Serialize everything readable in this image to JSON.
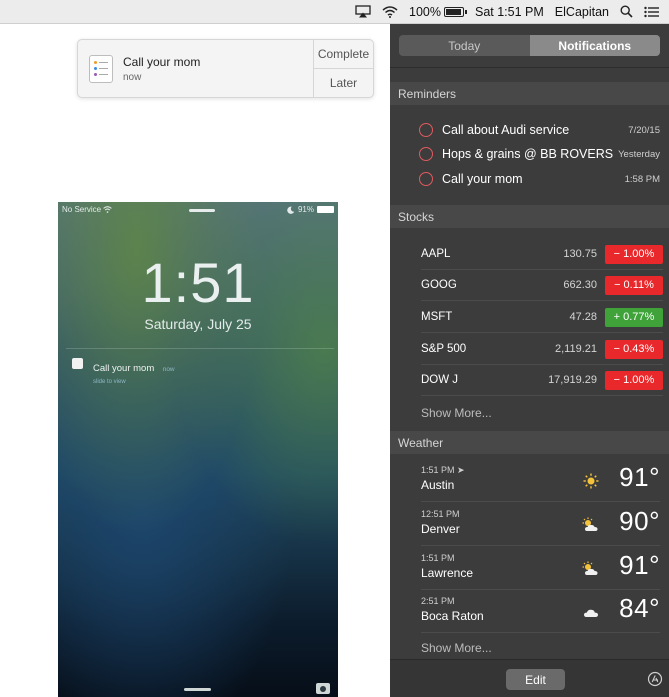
{
  "menubar": {
    "battery_percent": "100%",
    "clock": "Sat 1:51 PM",
    "user": "ElCapitan",
    "icons": [
      "airplay-icon",
      "wifi-icon",
      "battery-icon",
      "spotlight-search-icon",
      "notification-center-icon"
    ]
  },
  "banner": {
    "app_icon": "reminders-app-icon",
    "title": "Call your mom",
    "subtitle": "now",
    "complete_label": "Complete",
    "later_label": "Later"
  },
  "phone": {
    "carrier": "No Service",
    "battery": "91%",
    "time": "1:51",
    "date": "Saturday, July 25",
    "notification": {
      "title": "Call your mom",
      "time": "now",
      "subtitle": "slide to view"
    }
  },
  "notification_center": {
    "tabs": [
      {
        "label": "Today",
        "active": false
      },
      {
        "label": "Notifications",
        "active": true
      }
    ],
    "reminders": {
      "header": "Reminders",
      "items": [
        {
          "title": "Call about Audi service",
          "date": "7/20/15"
        },
        {
          "title": "Hops & grains @ BB ROVERS",
          "date": "Yesterday"
        },
        {
          "title": "Call your mom",
          "date": "1:58 PM"
        }
      ]
    },
    "stocks": {
      "header": "Stocks",
      "items": [
        {
          "symbol": "AAPL",
          "price": "130.75",
          "change": "− 1.00%",
          "direction": "down"
        },
        {
          "symbol": "GOOG",
          "price": "662.30",
          "change": "− 0.11%",
          "direction": "down"
        },
        {
          "symbol": "MSFT",
          "price": "47.28",
          "change": "+ 0.77%",
          "direction": "up"
        },
        {
          "symbol": "S&P 500",
          "price": "2,119.21",
          "change": "− 0.43%",
          "direction": "down"
        },
        {
          "symbol": "DOW J",
          "price": "17,919.29",
          "change": "− 1.00%",
          "direction": "down"
        }
      ],
      "show_more": "Show More..."
    },
    "weather": {
      "header": "Weather",
      "items": [
        {
          "time": "1:51 PM",
          "city": "Austin",
          "temp": "91°",
          "icon": "sun-icon"
        },
        {
          "time": "12:51 PM",
          "city": "Denver",
          "temp": "90°",
          "icon": "partly-cloudy-icon"
        },
        {
          "time": "1:51 PM",
          "city": "Lawrence",
          "temp": "91°",
          "icon": "partly-cloudy-icon"
        },
        {
          "time": "2:51 PM",
          "city": "Boca Raton",
          "temp": "84°",
          "icon": "cloud-icon"
        }
      ],
      "show_more": "Show More..."
    },
    "edit_label": "Edit"
  },
  "colors": {
    "down": "#e8282b",
    "up": "#3fa33a",
    "reminder_circle": "#e05a60",
    "sun": "#f5c33a"
  }
}
